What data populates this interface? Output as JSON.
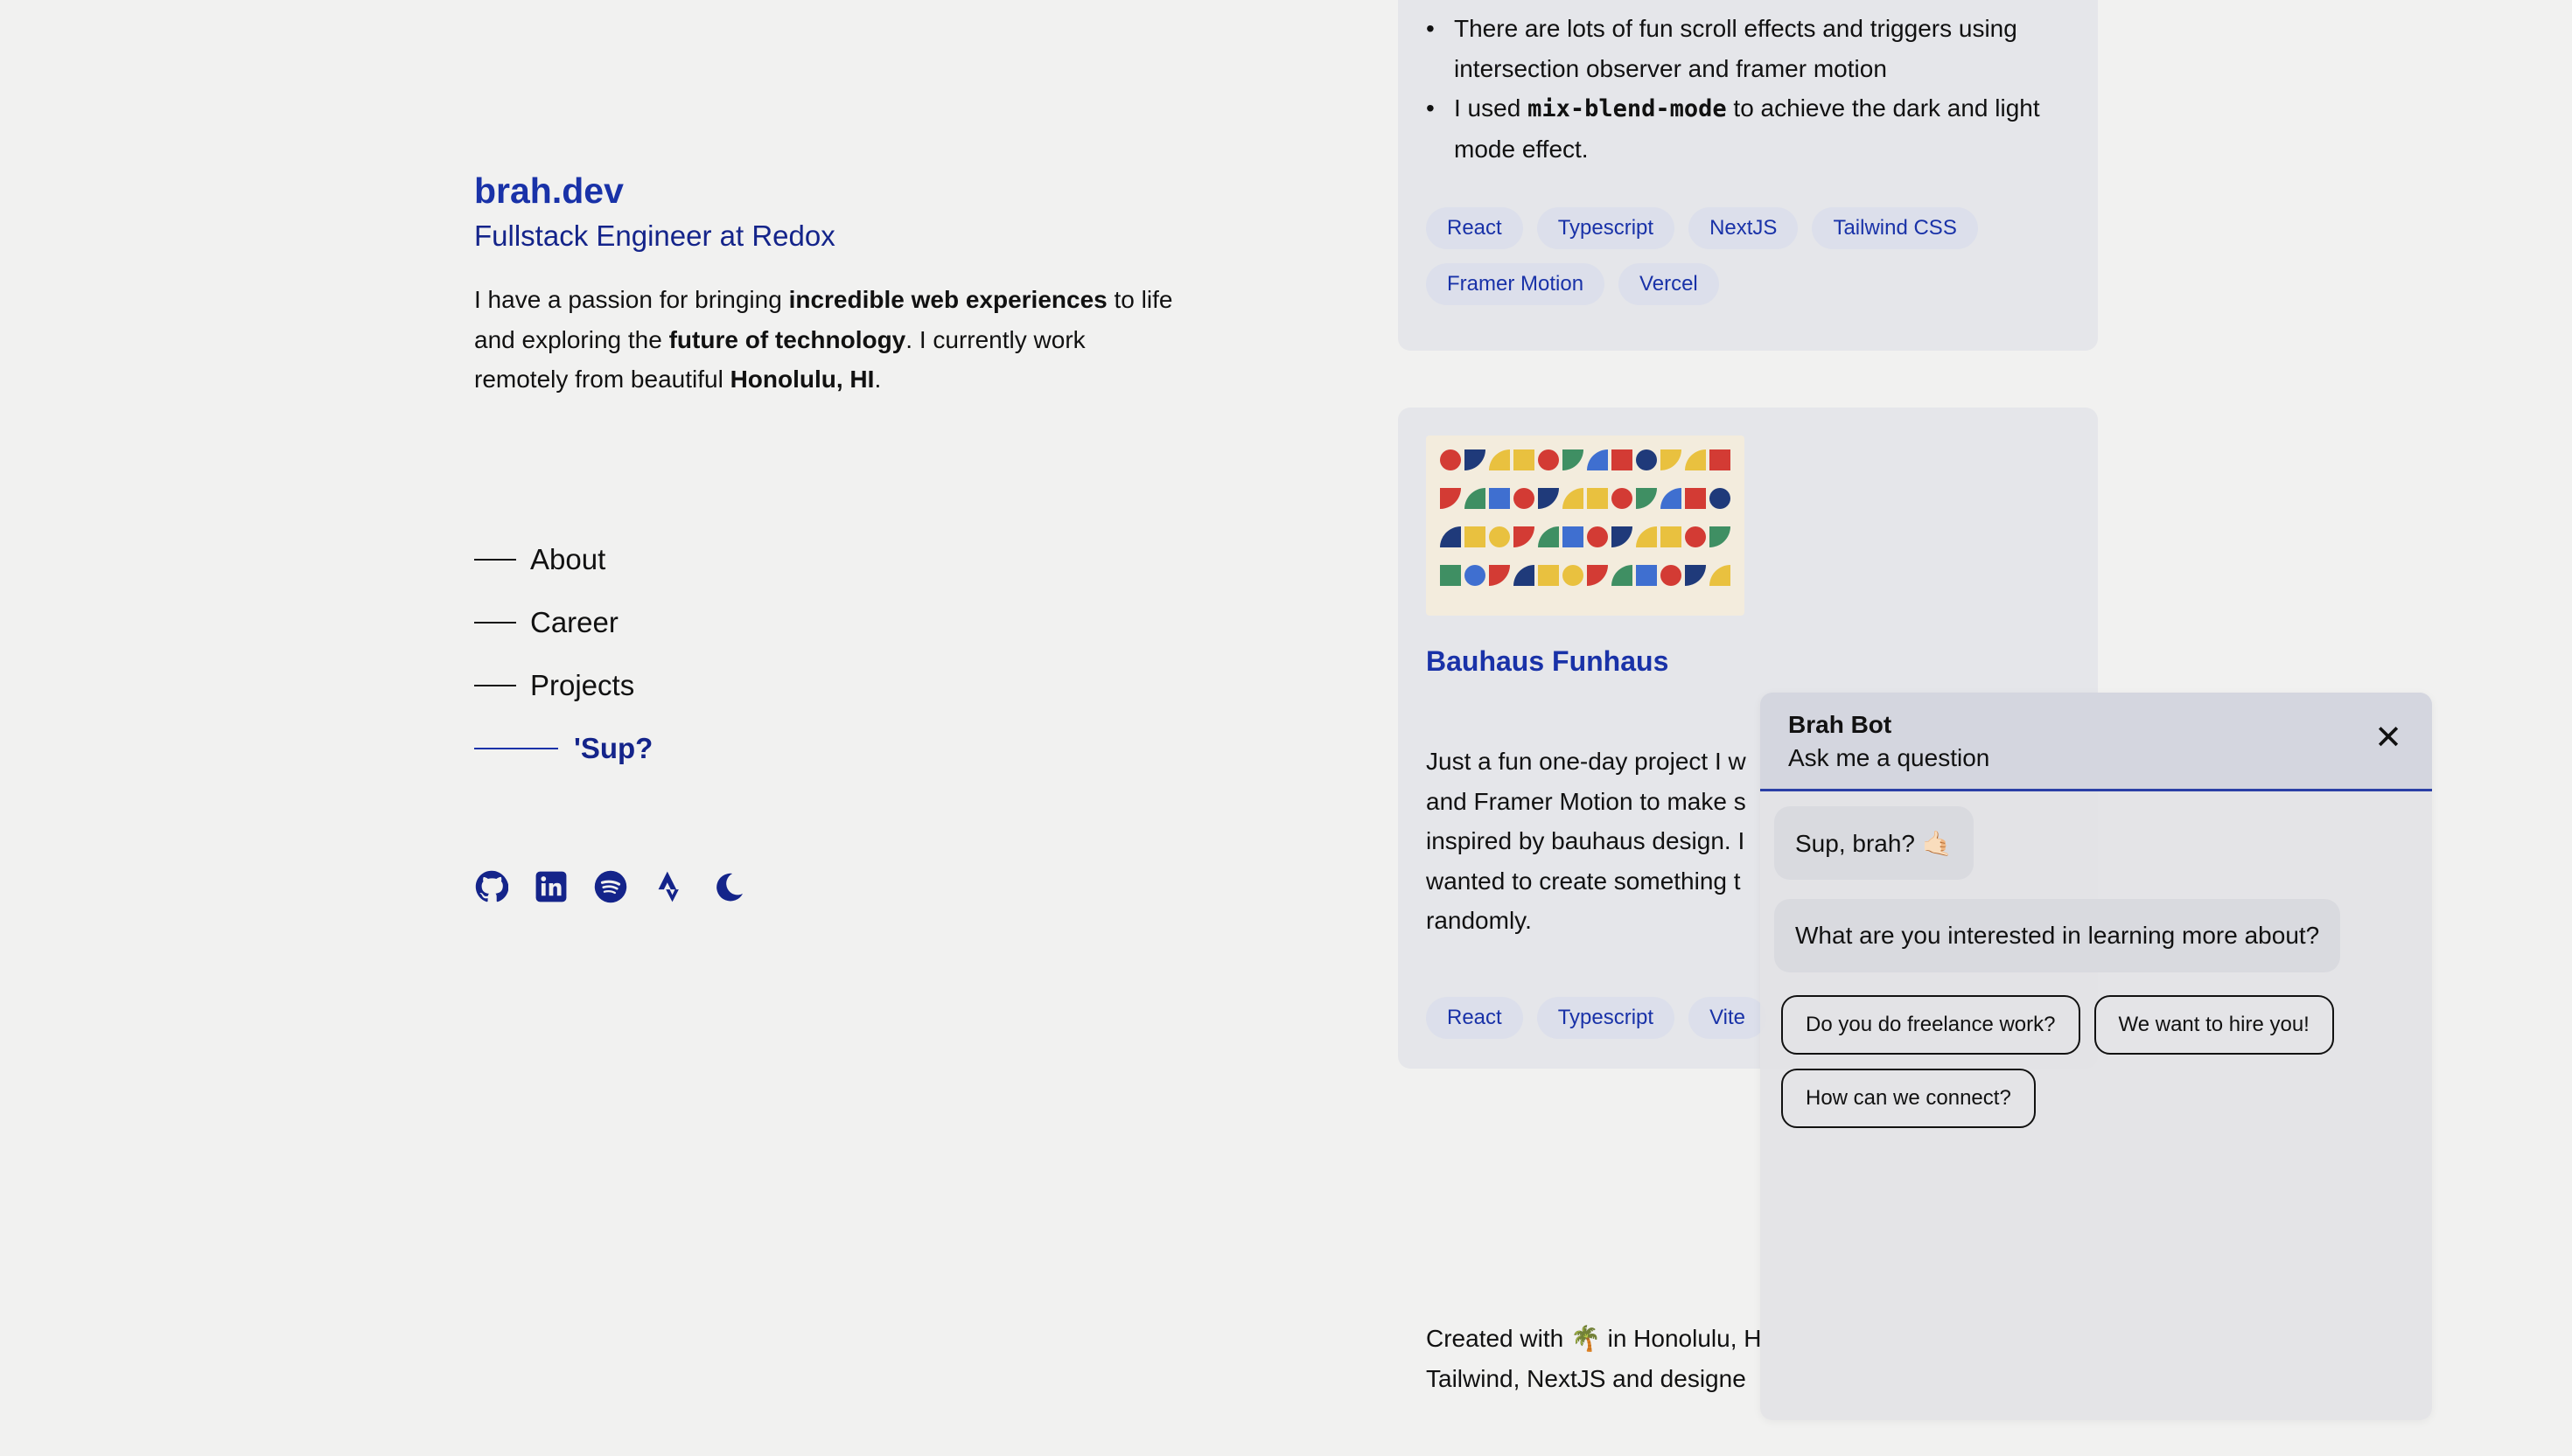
{
  "profile": {
    "site_name": "brah.dev",
    "role": "Fullstack Engineer at Redox",
    "intro": {
      "p1": "I have a passion for bringing ",
      "b1": "incredible web experiences",
      "p2": " to life and exploring the ",
      "b2": "future of technology",
      "p3": ". I currently work remotely from beautiful ",
      "b3": "Honolulu, HI",
      "p4": "."
    }
  },
  "nav": [
    {
      "label": "About"
    },
    {
      "label": "Career"
    },
    {
      "label": "Projects"
    },
    {
      "label": "'Sup?",
      "active": true
    }
  ],
  "socials": [
    "github-icon",
    "linkedin-icon",
    "spotify-icon",
    "strava-icon",
    "moon-icon"
  ],
  "project1": {
    "bullets": [
      "There are lots of fun scroll effects and triggers using intersection observer and framer motion",
      {
        "before": "I used ",
        "code": "mix-blend-mode",
        "after": " to achieve the dark and light mode effect."
      }
    ],
    "tags": [
      "React",
      "Typescript",
      "NextJS",
      "Tailwind CSS",
      "Framer Motion",
      "Vercel"
    ]
  },
  "project2": {
    "title": "Bauhaus Funhaus",
    "description": "Just a fun one-day project I w and Framer Motion to make s inspired by bauhaus design. I wanted to create something t randomly.",
    "desc_lines": [
      "Just a fun one-day project I w",
      "and Framer Motion to make s",
      "inspired by bauhaus design. I",
      "wanted to create something t",
      "randomly."
    ],
    "tags": [
      "React",
      "Typescript",
      "Vite"
    ]
  },
  "footer": {
    "line1": "Created with 🌴 in Honolulu, H",
    "line2": "Tailwind, NextJS and designe"
  },
  "chat": {
    "title": "Brah Bot",
    "subtitle": "Ask me a question",
    "close": "✕",
    "greeting": "Sup, brah? 🤙🏻",
    "question": "What are you interested in learning more about?",
    "options": [
      "Do you do freelance work?",
      "We want to hire you!",
      "How can we connect?"
    ]
  },
  "colors": {
    "accent": "#1932a8",
    "background": "#f1f1f0",
    "card": "#e5e6ea"
  }
}
